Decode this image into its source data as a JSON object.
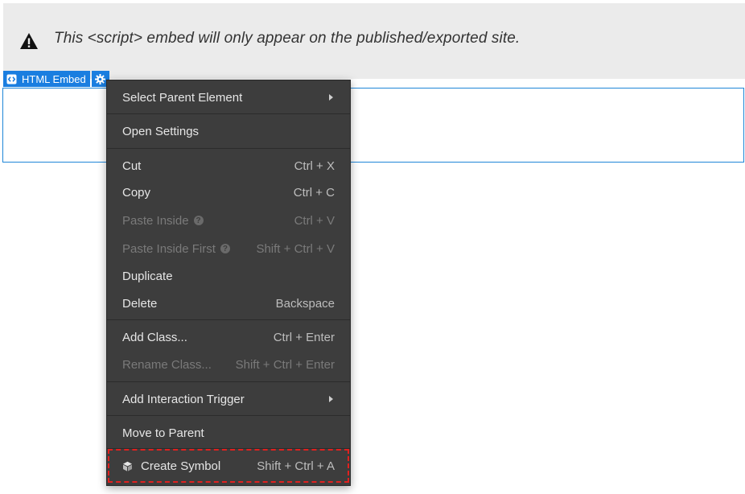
{
  "notice": {
    "icon": "warning-icon",
    "text": "This <script> embed will only appear on the published/exported site."
  },
  "element_badge": {
    "icon": "embed-icon",
    "label": "HTML Embed",
    "settings_icon": "gear-icon",
    "accent_color": "#1a7ee0"
  },
  "context_menu": {
    "background_color": "#3d3d3d",
    "highlight_color": "#e0211f",
    "items": [
      {
        "label": "Select Parent Element",
        "shortcut": "",
        "submenu": true,
        "disabled": false
      },
      {
        "label": "Open Settings",
        "shortcut": "",
        "submenu": false,
        "disabled": false
      },
      {
        "label": "Cut",
        "shortcut": "Ctrl + X",
        "submenu": false,
        "disabled": false
      },
      {
        "label": "Copy",
        "shortcut": "Ctrl + C",
        "submenu": false,
        "disabled": false
      },
      {
        "label": "Paste Inside",
        "shortcut": "Ctrl + V",
        "submenu": false,
        "disabled": true,
        "help_icon": "help-icon"
      },
      {
        "label": "Paste Inside First",
        "shortcut": "Shift + Ctrl + V",
        "submenu": false,
        "disabled": true,
        "help_icon": "help-icon"
      },
      {
        "label": "Duplicate",
        "shortcut": "",
        "submenu": false,
        "disabled": false
      },
      {
        "label": "Delete",
        "shortcut": "Backspace",
        "submenu": false,
        "disabled": false
      },
      {
        "label": "Add Class...",
        "shortcut": "Ctrl + Enter",
        "submenu": false,
        "disabled": false
      },
      {
        "label": "Rename Class...",
        "shortcut": "Shift + Ctrl + Enter",
        "submenu": false,
        "disabled": true
      },
      {
        "label": "Add Interaction Trigger",
        "shortcut": "",
        "submenu": true,
        "disabled": false
      },
      {
        "label": "Move to Parent",
        "shortcut": "",
        "submenu": false,
        "disabled": false
      },
      {
        "label": "Create Symbol",
        "shortcut": "Shift + Ctrl + A",
        "submenu": false,
        "disabled": false,
        "icon": "symbol-cube-icon",
        "highlighted": true
      }
    ]
  }
}
